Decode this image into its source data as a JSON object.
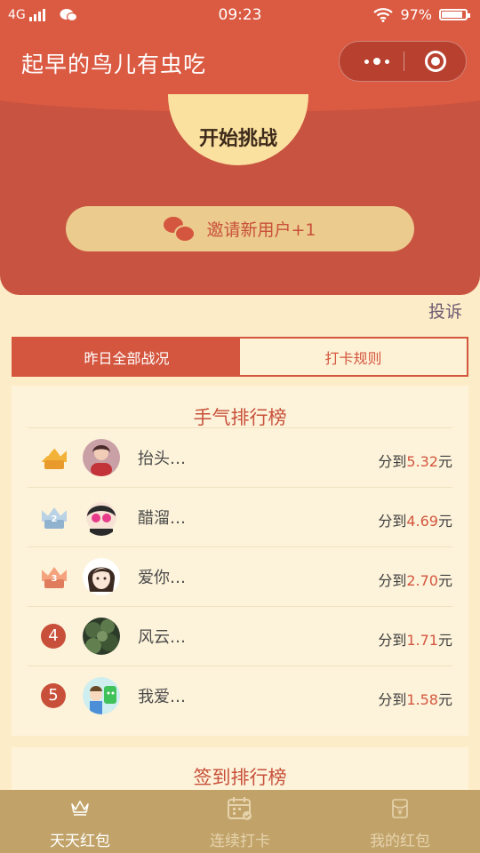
{
  "status_bar": {
    "network": "4G",
    "time": "09:23",
    "battery": "97%"
  },
  "nav": {
    "title": "起早的鸟儿有虫吃"
  },
  "hero": {
    "start_label": "开始挑战",
    "invite_label": "邀请新用户+1"
  },
  "complain_label": "投诉",
  "tabs": [
    {
      "label": "昨日全部战况",
      "active": true
    },
    {
      "label": "打卡规则",
      "active": false
    }
  ],
  "luck_ranking": {
    "title": "手气排行榜",
    "rows": [
      {
        "rank": "1",
        "nickname": "抬头…",
        "prefix": "分到",
        "amount": "5.32",
        "suffix": "元"
      },
      {
        "rank": "2",
        "nickname": "醋溜…",
        "prefix": "分到",
        "amount": "4.69",
        "suffix": "元"
      },
      {
        "rank": "3",
        "nickname": "爱你…",
        "prefix": "分到",
        "amount": "2.70",
        "suffix": "元"
      },
      {
        "rank": "4",
        "nickname": "风云…",
        "prefix": "分到",
        "amount": "1.71",
        "suffix": "元"
      },
      {
        "rank": "5",
        "nickname": "我爱…",
        "prefix": "分到",
        "amount": "1.58",
        "suffix": "元"
      }
    ]
  },
  "checkin_ranking": {
    "title": "签到排行榜"
  },
  "tabbar": [
    {
      "label": "天天红包",
      "icon": "crown-icon",
      "active": true
    },
    {
      "label": "连续打卡",
      "icon": "calendar-icon",
      "active": false
    },
    {
      "label": "我的红包",
      "icon": "red-packet-icon",
      "active": false
    }
  ],
  "colors": {
    "primary": "#db5a42",
    "hero": "#c85340",
    "background": "#fdecc8",
    "accent_gold": "#fbe1a0",
    "tabbar": "#c1a36a"
  }
}
